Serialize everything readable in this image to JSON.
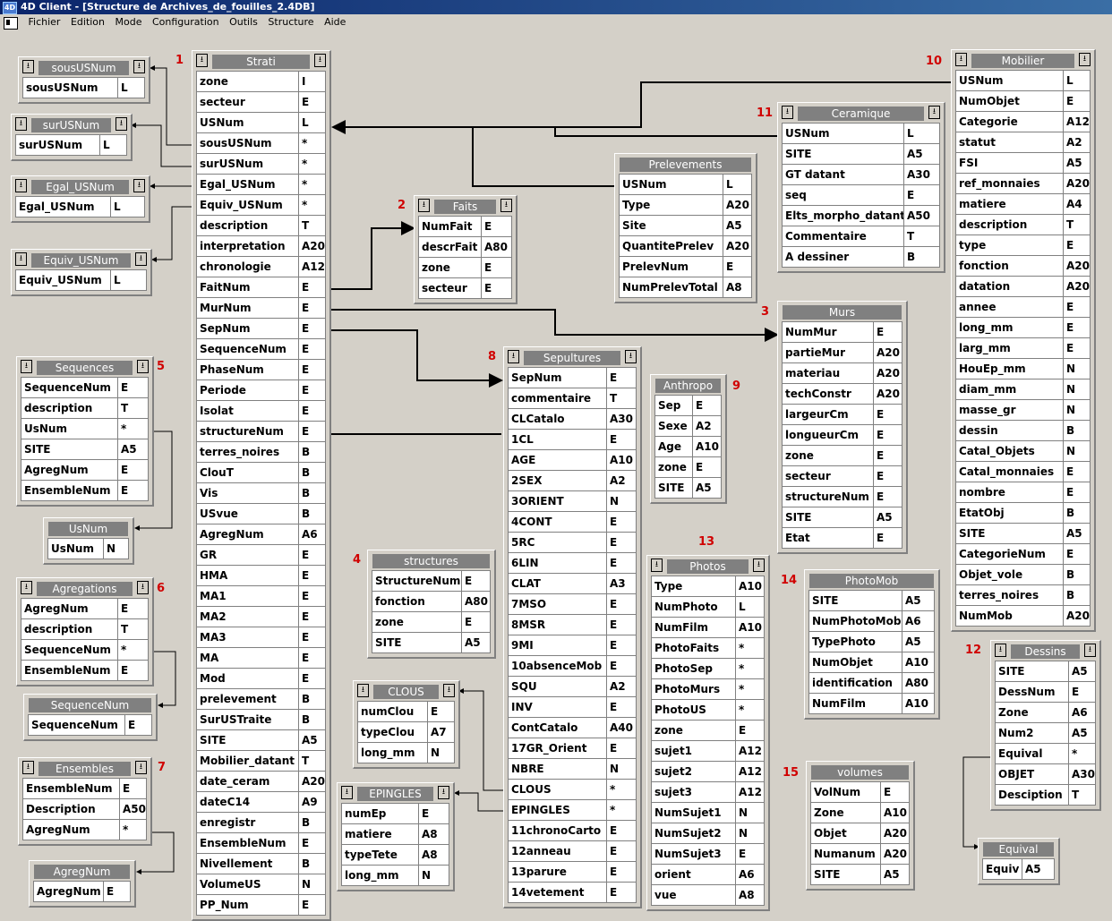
{
  "window": {
    "title": "4D Client - [Structure de Archives_de_fouilles_2.4DB]",
    "logo": "4D"
  },
  "menu": [
    "Fichier",
    "Edition",
    "Mode",
    "Configuration",
    "Outils",
    "Structure",
    "Aide"
  ],
  "numbers": [
    {
      "label": "1",
      "table": "Strati"
    },
    {
      "label": "2",
      "table": "Faits"
    },
    {
      "label": "3",
      "table": "Murs"
    },
    {
      "label": "4",
      "table": "structures"
    },
    {
      "label": "5",
      "table": "Sequences"
    },
    {
      "label": "6",
      "table": "Agregations"
    },
    {
      "label": "7",
      "table": "Ensembles"
    },
    {
      "label": "8",
      "table": "Sepultures"
    },
    {
      "label": "9",
      "table": "Anthropo"
    },
    {
      "label": "10",
      "table": "Mobilier"
    },
    {
      "label": "11",
      "table": "Ceramique"
    },
    {
      "label": "12",
      "table": "Dessins"
    },
    {
      "label": "13",
      "table": "Photos"
    },
    {
      "label": "14",
      "table": "PhotoMob"
    },
    {
      "label": "15",
      "table": "volumes"
    }
  ],
  "tables": [
    {
      "name": "sousUSNum",
      "buttons": true,
      "fields": [
        [
          "sousUSNum",
          "L"
        ]
      ]
    },
    {
      "name": "surUSNum",
      "buttons": true,
      "fields": [
        [
          "surUSNum",
          "L"
        ]
      ]
    },
    {
      "name": "Egal_USNum",
      "buttons": true,
      "fields": [
        [
          "Egal_USNum",
          "L"
        ]
      ]
    },
    {
      "name": "Equiv_USNum",
      "buttons": true,
      "fields": [
        [
          "Equiv_USNum",
          "L"
        ]
      ]
    },
    {
      "name": "Sequences",
      "buttons": true,
      "fields": [
        [
          "SequenceNum",
          "E"
        ],
        [
          "description",
          "T"
        ],
        [
          "UsNum",
          "*"
        ],
        [
          "SITE",
          "A5"
        ],
        [
          "AgregNum",
          "E"
        ],
        [
          "EnsembleNum",
          "E"
        ]
      ]
    },
    {
      "name": "UsNum",
      "buttons": false,
      "fields": [
        [
          "UsNum",
          "N"
        ]
      ]
    },
    {
      "name": "Agregations",
      "buttons": true,
      "fields": [
        [
          "AgregNum",
          "E"
        ],
        [
          "description",
          "T"
        ],
        [
          "SequenceNum",
          "*"
        ],
        [
          "EnsembleNum",
          "E"
        ]
      ]
    },
    {
      "name": "SequenceNum",
      "buttons": false,
      "fields": [
        [
          "SequenceNum",
          "E"
        ]
      ]
    },
    {
      "name": "Ensembles",
      "buttons": true,
      "fields": [
        [
          "EnsembleNum",
          "E"
        ],
        [
          "Description",
          "A50"
        ],
        [
          "AgregNum",
          "*"
        ]
      ]
    },
    {
      "name": "AgregNum",
      "buttons": false,
      "fields": [
        [
          "AgregNum",
          "E"
        ]
      ]
    },
    {
      "name": "Strati",
      "buttons": true,
      "fields": [
        [
          "zone",
          "I"
        ],
        [
          "secteur",
          "E"
        ],
        [
          "USNum",
          "L"
        ],
        [
          "sousUSNum",
          "*"
        ],
        [
          "surUSNum",
          "*"
        ],
        [
          "Egal_USNum",
          "*"
        ],
        [
          "Equiv_USNum",
          "*"
        ],
        [
          "description",
          "T"
        ],
        [
          "interpretation",
          "A20"
        ],
        [
          "chronologie",
          "A12"
        ],
        [
          "FaitNum",
          "E"
        ],
        [
          "MurNum",
          "E"
        ],
        [
          "SepNum",
          "E"
        ],
        [
          "SequenceNum",
          "E"
        ],
        [
          "PhaseNum",
          "E"
        ],
        [
          "Periode",
          "E"
        ],
        [
          "Isolat",
          "E"
        ],
        [
          "structureNum",
          "E"
        ],
        [
          "terres_noires",
          "B"
        ],
        [
          "ClouT",
          "B"
        ],
        [
          "Vis",
          "B"
        ],
        [
          "USvue",
          "B"
        ],
        [
          "AgregNum",
          "A6"
        ],
        [
          "GR",
          "E"
        ],
        [
          "HMA",
          "E"
        ],
        [
          "MA1",
          "E"
        ],
        [
          "MA2",
          "E"
        ],
        [
          "MA3",
          "E"
        ],
        [
          "MA",
          "E"
        ],
        [
          "Mod",
          "E"
        ],
        [
          "prelevement",
          "B"
        ],
        [
          "SurUSTraite",
          "B"
        ],
        [
          "SITE",
          "A5"
        ],
        [
          "Mobilier_datant",
          "T"
        ],
        [
          "date_ceram",
          "A20"
        ],
        [
          "dateC14",
          "A9"
        ],
        [
          "enregistr",
          "B"
        ],
        [
          "EnsembleNum",
          "E"
        ],
        [
          "Nivellement",
          "B"
        ],
        [
          "VolumeUS",
          "N"
        ],
        [
          "PP_Num",
          "E"
        ]
      ]
    },
    {
      "name": "Faits",
      "buttons": true,
      "fields": [
        [
          "NumFait",
          "E"
        ],
        [
          "descrFait",
          "A80"
        ],
        [
          "zone",
          "E"
        ],
        [
          "secteur",
          "E"
        ]
      ]
    },
    {
      "name": "structures",
      "buttons": false,
      "fields": [
        [
          "StructureNum",
          "E"
        ],
        [
          "fonction",
          "A80"
        ],
        [
          "zone",
          "E"
        ],
        [
          "SITE",
          "A5"
        ]
      ]
    },
    {
      "name": "CLOUS",
      "buttons": true,
      "fields": [
        [
          "numClou",
          "E"
        ],
        [
          "typeClou",
          "A7"
        ],
        [
          "long_mm",
          "N"
        ]
      ]
    },
    {
      "name": "EPINGLES",
      "buttons": true,
      "fields": [
        [
          "numEp",
          "E"
        ],
        [
          "matiere",
          "A8"
        ],
        [
          "typeTete",
          "A8"
        ],
        [
          "long_mm",
          "N"
        ]
      ]
    },
    {
      "name": "Prelevements",
      "buttons": false,
      "fields": [
        [
          "USNum",
          "L"
        ],
        [
          "Type",
          "A20"
        ],
        [
          "Site",
          "A5"
        ],
        [
          "QuantitePrelev",
          "A20"
        ],
        [
          "PrelevNum",
          "E"
        ],
        [
          "NumPrelevTotal",
          "A8"
        ]
      ]
    },
    {
      "name": "Sepultures",
      "buttons": true,
      "fields": [
        [
          "SepNum",
          "E"
        ],
        [
          "commentaire",
          "T"
        ],
        [
          "CLCatalo",
          "A30"
        ],
        [
          "1CL",
          "E"
        ],
        [
          "AGE",
          "A10"
        ],
        [
          "2SEX",
          "A2"
        ],
        [
          "3ORIENT",
          "N"
        ],
        [
          "4CONT",
          "E"
        ],
        [
          "5RC",
          "E"
        ],
        [
          "6LIN",
          "E"
        ],
        [
          "CLAT",
          "A3"
        ],
        [
          "7MSO",
          "E"
        ],
        [
          "8MSR",
          "E"
        ],
        [
          "9MI",
          "E"
        ],
        [
          "10absenceMob",
          "E"
        ],
        [
          "SQU",
          "A2"
        ],
        [
          "INV",
          "E"
        ],
        [
          "ContCatalo",
          "A40"
        ],
        [
          "17GR_Orient",
          "E"
        ],
        [
          "NBRE",
          "N"
        ],
        [
          "CLOUS",
          "*"
        ],
        [
          "EPINGLES",
          "*"
        ],
        [
          "11chronoCarto",
          "E"
        ],
        [
          "12anneau",
          "E"
        ],
        [
          "13parure",
          "E"
        ],
        [
          "14vetement",
          "E"
        ]
      ]
    },
    {
      "name": "Anthropo",
      "buttons": false,
      "fields": [
        [
          "Sep",
          "E"
        ],
        [
          "Sexe",
          "A2"
        ],
        [
          "Age",
          "A10"
        ],
        [
          "zone",
          "E"
        ],
        [
          "SITE",
          "A5"
        ]
      ]
    },
    {
      "name": "Photos",
      "buttons": true,
      "fields": [
        [
          "Type",
          "A10"
        ],
        [
          "NumPhoto",
          "L"
        ],
        [
          "NumFilm",
          "A10"
        ],
        [
          "PhotoFaits",
          "*"
        ],
        [
          "PhotoSep",
          "*"
        ],
        [
          "PhotoMurs",
          "*"
        ],
        [
          "PhotoUS",
          "*"
        ],
        [
          "zone",
          "E"
        ],
        [
          "sujet1",
          "A12"
        ],
        [
          "sujet2",
          "A12"
        ],
        [
          "sujet3",
          "A12"
        ],
        [
          "NumSujet1",
          "N"
        ],
        [
          "NumSujet2",
          "N"
        ],
        [
          "NumSujet3",
          "E"
        ],
        [
          "orient",
          "A6"
        ],
        [
          "vue",
          "A8"
        ]
      ]
    },
    {
      "name": "Ceramique",
      "buttons": true,
      "fields": [
        [
          "USNum",
          "L"
        ],
        [
          "SITE",
          "A5"
        ],
        [
          "GT datant",
          "A30"
        ],
        [
          "seq",
          "E"
        ],
        [
          "Elts_morpho_datant",
          "A50"
        ],
        [
          "Commentaire",
          "T"
        ],
        [
          "A dessiner",
          "B"
        ]
      ]
    },
    {
      "name": "Murs",
      "buttons": false,
      "fields": [
        [
          "NumMur",
          "E"
        ],
        [
          "partieMur",
          "A20"
        ],
        [
          "materiau",
          "A20"
        ],
        [
          "techConstr",
          "A20"
        ],
        [
          "largeurCm",
          "E"
        ],
        [
          "longueurCm",
          "E"
        ],
        [
          "zone",
          "E"
        ],
        [
          "secteur",
          "E"
        ],
        [
          "structureNum",
          "E"
        ],
        [
          "SITE",
          "A5"
        ],
        [
          "Etat",
          "E"
        ]
      ]
    },
    {
      "name": "PhotoMob",
      "buttons": false,
      "fields": [
        [
          "SITE",
          "A5"
        ],
        [
          "NumPhotoMob",
          "A6"
        ],
        [
          "TypePhoto",
          "A5"
        ],
        [
          "NumObjet",
          "A10"
        ],
        [
          "identification",
          "A80"
        ],
        [
          "NumFilm",
          "A10"
        ]
      ]
    },
    {
      "name": "volumes",
      "buttons": false,
      "fields": [
        [
          "VolNum",
          "E"
        ],
        [
          "Zone",
          "A10"
        ],
        [
          "Objet",
          "A20"
        ],
        [
          "Numanum",
          "A20"
        ],
        [
          "SITE",
          "A5"
        ]
      ]
    },
    {
      "name": "Mobilier",
      "buttons": true,
      "fields": [
        [
          "USNum",
          "L"
        ],
        [
          "NumObjet",
          "E"
        ],
        [
          "Categorie",
          "A12"
        ],
        [
          "statut",
          "A2"
        ],
        [
          "FSI",
          "A5"
        ],
        [
          "ref_monnaies",
          "A20"
        ],
        [
          "matiere",
          "A4"
        ],
        [
          "description",
          "T"
        ],
        [
          "type",
          "E"
        ],
        [
          "fonction",
          "A20"
        ],
        [
          "datation",
          "A20"
        ],
        [
          "annee",
          "E"
        ],
        [
          "long_mm",
          "E"
        ],
        [
          "larg_mm",
          "E"
        ],
        [
          "HouEp_mm",
          "N"
        ],
        [
          "diam_mm",
          "N"
        ],
        [
          "masse_gr",
          "N"
        ],
        [
          "dessin",
          "B"
        ],
        [
          "Catal_Objets",
          "N"
        ],
        [
          "Catal_monnaies",
          "E"
        ],
        [
          "nombre",
          "E"
        ],
        [
          "EtatObj",
          "B"
        ],
        [
          "SITE",
          "A5"
        ],
        [
          "CategorieNum",
          "E"
        ],
        [
          "Objet_vole",
          "B"
        ],
        [
          "terres_noires",
          "B"
        ],
        [
          "NumMob",
          "A20"
        ]
      ]
    },
    {
      "name": "Dessins",
      "buttons": true,
      "fields": [
        [
          "SITE",
          "A5"
        ],
        [
          "DessNum",
          "E"
        ],
        [
          "Zone",
          "A6"
        ],
        [
          "Num2",
          "A5"
        ],
        [
          "Equival",
          "*"
        ],
        [
          "OBJET",
          "A30"
        ],
        [
          "Desciption",
          "T"
        ]
      ]
    },
    {
      "name": "Equival",
      "buttons": false,
      "fields": [
        [
          "Equiv",
          "A5"
        ]
      ]
    }
  ]
}
